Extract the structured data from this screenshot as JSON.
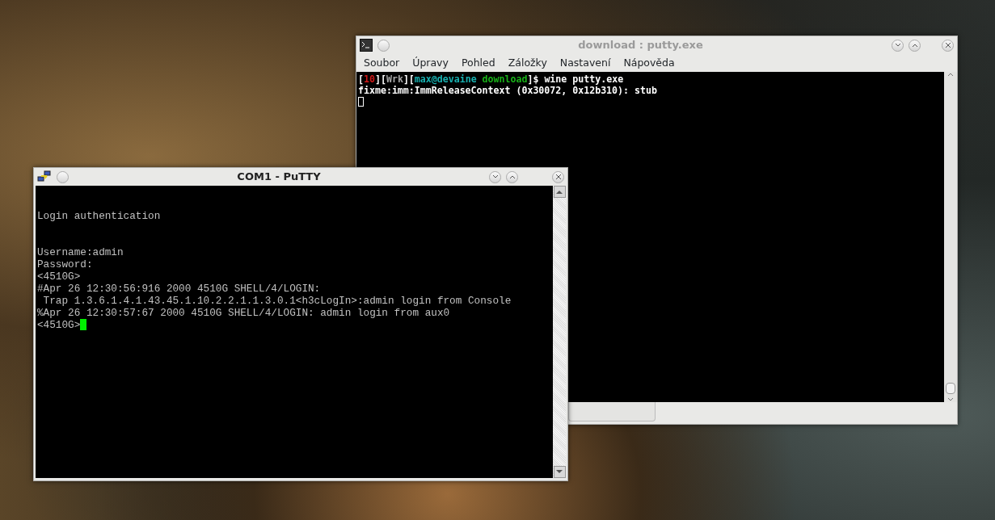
{
  "konsole": {
    "title": "download : putty.exe",
    "menu": [
      "Soubor",
      "Úpravy",
      "Pohled",
      "Záložky",
      "Nastavení",
      "Nápověda"
    ],
    "lines": [
      {
        "segments": [
          {
            "text": "[",
            "color": "#ffffff"
          },
          {
            "text": "10",
            "color": "#d01818"
          },
          {
            "text": "][",
            "color": "#ffffff"
          },
          {
            "text": "Wrk",
            "color": "#a8a8a8"
          },
          {
            "text": "][",
            "color": "#ffffff"
          },
          {
            "text": "max@devaine",
            "color": "#18b2b2"
          },
          {
            "text": " download",
            "color": "#18b218"
          },
          {
            "text": "]$ wine putty.exe",
            "color": "#ffffff"
          }
        ]
      },
      {
        "segments": [
          {
            "text": "fixme:imm:ImmReleaseContext (0x30072, 0x12b310): stub",
            "color": "#ffffff"
          }
        ]
      }
    ]
  },
  "putty": {
    "title": "COM1 - PuTTY",
    "blocks": [
      [
        "Login authentication"
      ],
      [
        "Username:admin",
        "Password:",
        "<4510G>",
        "#Apr 26 12:30:56:916 2000 4510G SHELL/4/LOGIN:",
        " Trap 1.3.6.1.4.1.43.45.1.10.2.2.1.1.3.0.1<h3cLogIn>:admin login from Console",
        "%Apr 26 12:30:57:67 2000 4510G SHELL/4/LOGIN: admin login from aux0",
        "<4510G>"
      ]
    ]
  }
}
